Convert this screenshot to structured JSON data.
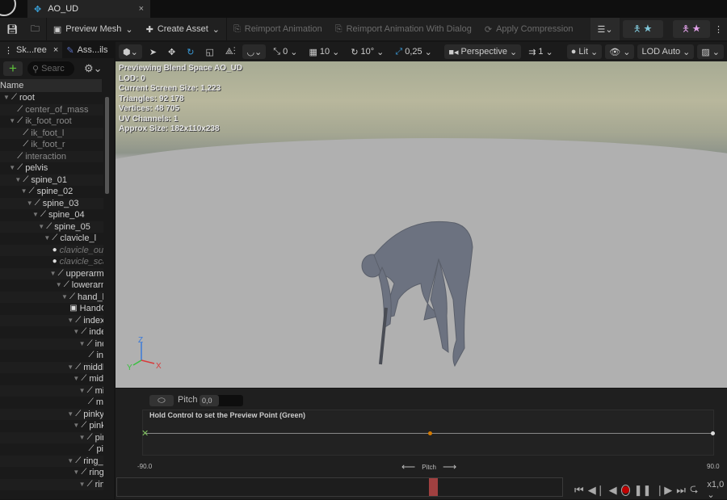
{
  "tab": {
    "title": "AO_UD",
    "close": "×"
  },
  "toolbar": {
    "preview_mesh": "Preview Mesh",
    "create_asset": "Create Asset",
    "reimport": "Reimport Animation",
    "reimport_dialog": "Reimport Animation With Dialog",
    "apply_compression": "Apply Compression"
  },
  "panel": {
    "tabs": [
      "Sk...ree",
      "Ass...ils"
    ],
    "close": "×",
    "search_placeholder": "Searc",
    "column": "Name",
    "bones": [
      {
        "name": "root",
        "level": 0,
        "arrow": true
      },
      {
        "name": "center_of_mass",
        "level": 1,
        "dim": true
      },
      {
        "name": "ik_foot_root",
        "level": 1,
        "arrow": true,
        "dim": true
      },
      {
        "name": "ik_foot_l",
        "level": 2,
        "dim": true
      },
      {
        "name": "ik_foot_r",
        "level": 2,
        "dim": true
      },
      {
        "name": "interaction",
        "level": 1,
        "dim": true
      },
      {
        "name": "pelvis",
        "level": 1,
        "arrow": true
      },
      {
        "name": "spine_01",
        "level": 2,
        "arrow": true
      },
      {
        "name": "spine_02",
        "level": 3,
        "arrow": true
      },
      {
        "name": "spine_03",
        "level": 4,
        "arrow": true
      },
      {
        "name": "spine_04",
        "level": 5,
        "arrow": true
      },
      {
        "name": "spine_05",
        "level": 6,
        "arrow": true
      },
      {
        "name": "clavicle_l",
        "level": 7,
        "arrow": true
      },
      {
        "name": "clavicle_out",
        "level": 8,
        "socket": true
      },
      {
        "name": "clavicle_sca",
        "level": 8,
        "socket": true
      },
      {
        "name": "upperarm_l",
        "level": 8,
        "arrow": true
      },
      {
        "name": "lowerarm_",
        "level": 9,
        "arrow": true
      },
      {
        "name": "hand_l",
        "level": 10,
        "arrow": true
      },
      {
        "name": "HandG",
        "level": 11,
        "mesh": true
      },
      {
        "name": "index_",
        "level": 11,
        "arrow": true
      },
      {
        "name": "index",
        "level": 12,
        "arrow": true
      },
      {
        "name": "ind",
        "level": 13,
        "arrow": true
      },
      {
        "name": "in",
        "level": 14
      },
      {
        "name": "middle",
        "level": 11,
        "arrow": true
      },
      {
        "name": "midd",
        "level": 12,
        "arrow": true
      },
      {
        "name": "mic",
        "level": 13,
        "arrow": true
      },
      {
        "name": "m",
        "level": 14
      },
      {
        "name": "pinky_",
        "level": 11,
        "arrow": true
      },
      {
        "name": "pinky",
        "level": 12,
        "arrow": true
      },
      {
        "name": "pin",
        "level": 13,
        "arrow": true
      },
      {
        "name": "pi",
        "level": 14
      },
      {
        "name": "ring_m",
        "level": 11,
        "arrow": true
      },
      {
        "name": "ring_",
        "level": 12,
        "arrow": true
      },
      {
        "name": "ring",
        "level": 13,
        "arrow": true
      }
    ]
  },
  "viewport_toolbar": {
    "snap_rot": "0",
    "grid": "10",
    "angle": "10°",
    "scale": "0,25",
    "perspective": "Perspective",
    "cam_speed": "1",
    "lit": "Lit",
    "lod": "LOD Auto"
  },
  "stats": [
    "Previewing Blend Space AO_UD",
    "LOD: 0",
    "Current Screen Size: 1,223",
    "Triangles: 92 178",
    "Vertices: 48 705",
    "UV Channels: 1",
    "Approx Size: 182x110x238"
  ],
  "axes": {
    "z": "Z",
    "y": "Y",
    "x": "X"
  },
  "blendspace": {
    "param_label": "Pitch",
    "param_value": "0,0",
    "hint": "Hold Control to set the Preview Point (Green)",
    "min": "-90.0",
    "max": "90.0",
    "axis_label": "Pitch",
    "sample_fraction": 0.5,
    "preview_fraction": 0.0
  },
  "playback": {
    "speed": "x1,0",
    "position_fraction": 0.7
  },
  "colors": {
    "accent": "#d47a00",
    "record": "#c00000",
    "scrub_marker": "#a04040"
  }
}
